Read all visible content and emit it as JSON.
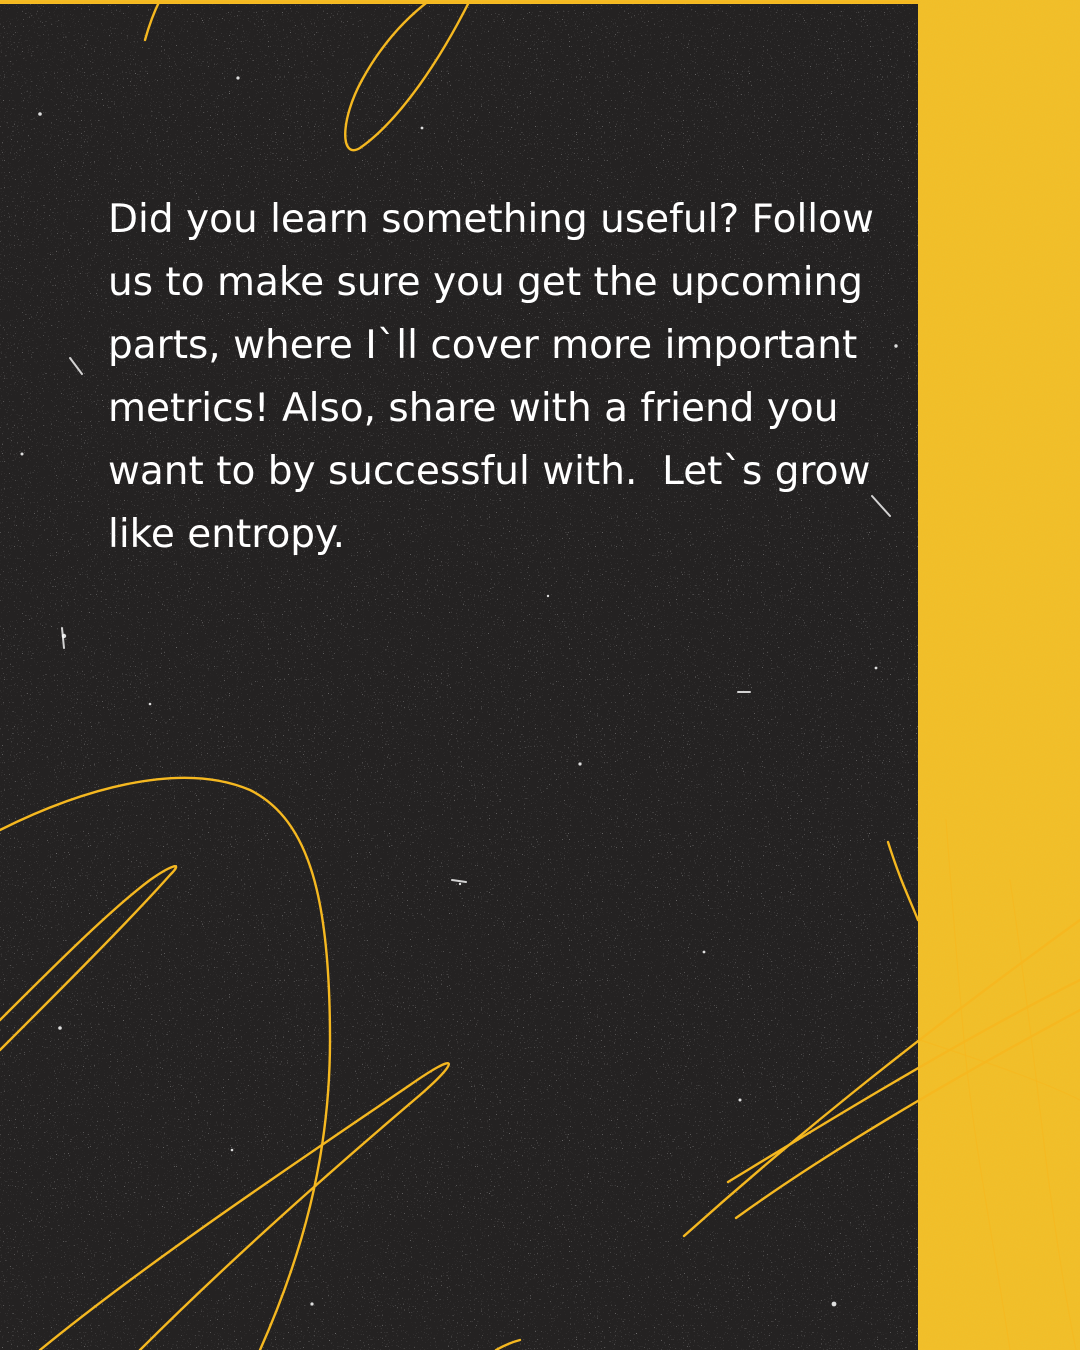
{
  "body": {
    "text": "Did you learn something useful? Follow us to make sure you get the upcoming parts, where I`ll cover more important metrics! Also, share with a friend you want to by successful with.  Let`s grow like entropy."
  },
  "colors": {
    "background_accent": "#f3bd26",
    "panel": "#242222",
    "text": "#ffffff",
    "scribble": "#f5b820"
  },
  "decorations": {
    "panel_texture": "speckled-chalkboard",
    "accent_texture": "yellow-stucco",
    "scribble_style": "hand-drawn-yellow-loops"
  }
}
